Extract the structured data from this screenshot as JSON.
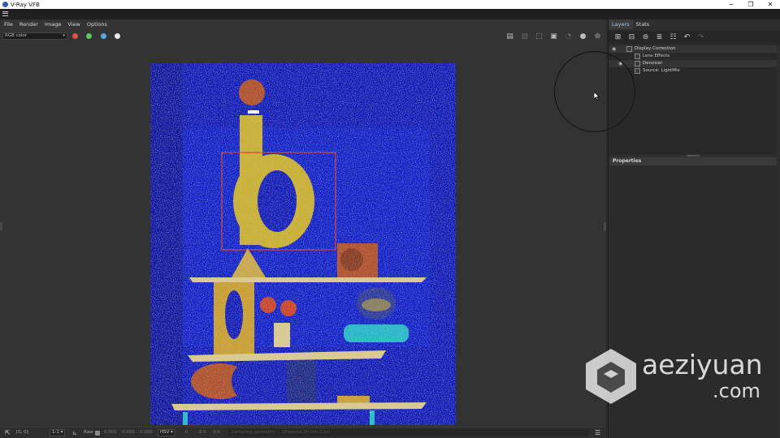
{
  "window": {
    "title": "V-Ray VFB",
    "controls": [
      "─",
      "❐",
      "✕"
    ]
  },
  "menu": {
    "items": [
      "File",
      "Render",
      "Image",
      "View",
      "Options"
    ]
  },
  "toolbar": {
    "channel": "RGB color",
    "channel_dots": [
      "#e05050",
      "#5bc95b",
      "#55a8e8",
      "#e8e8e8"
    ],
    "icons": [
      "save-icon",
      "clear-icon",
      "region-icon",
      "frame-icon",
      "teapot-icon",
      "render-icon",
      "stop-icon"
    ]
  },
  "panel": {
    "tabs": [
      "Layers",
      "Stats"
    ],
    "active_tab": "Layers",
    "layer_tools": [
      "add-layer-icon",
      "save-layers-icon",
      "load-layers-icon",
      "stack-icon",
      "list-icon",
      "undo-icon",
      "redo-icon"
    ],
    "layers": [
      {
        "label": "Display Correction",
        "level": 0,
        "eye": true
      },
      {
        "label": "Lens Effects",
        "level": 1,
        "eye": false
      },
      {
        "label": "Denoiser",
        "level": 1,
        "eye": true
      },
      {
        "label": "Source: LightMix",
        "level": 1,
        "eye": false
      }
    ],
    "properties_title": "Properties"
  },
  "status": {
    "coords": "[0, 0]",
    "zoom": "1:1",
    "mode_label": "Raw",
    "raw_values": [
      "0.000",
      "0.000",
      "0.000"
    ],
    "color_space": "HSV",
    "hsv_values": [
      "0",
      "0.0",
      "0.0"
    ],
    "message": "Sampling geometry ... [Elapsed 0h 0m 3.5s]"
  },
  "watermark": {
    "text": "aeziyuan",
    "sub": ".com"
  }
}
